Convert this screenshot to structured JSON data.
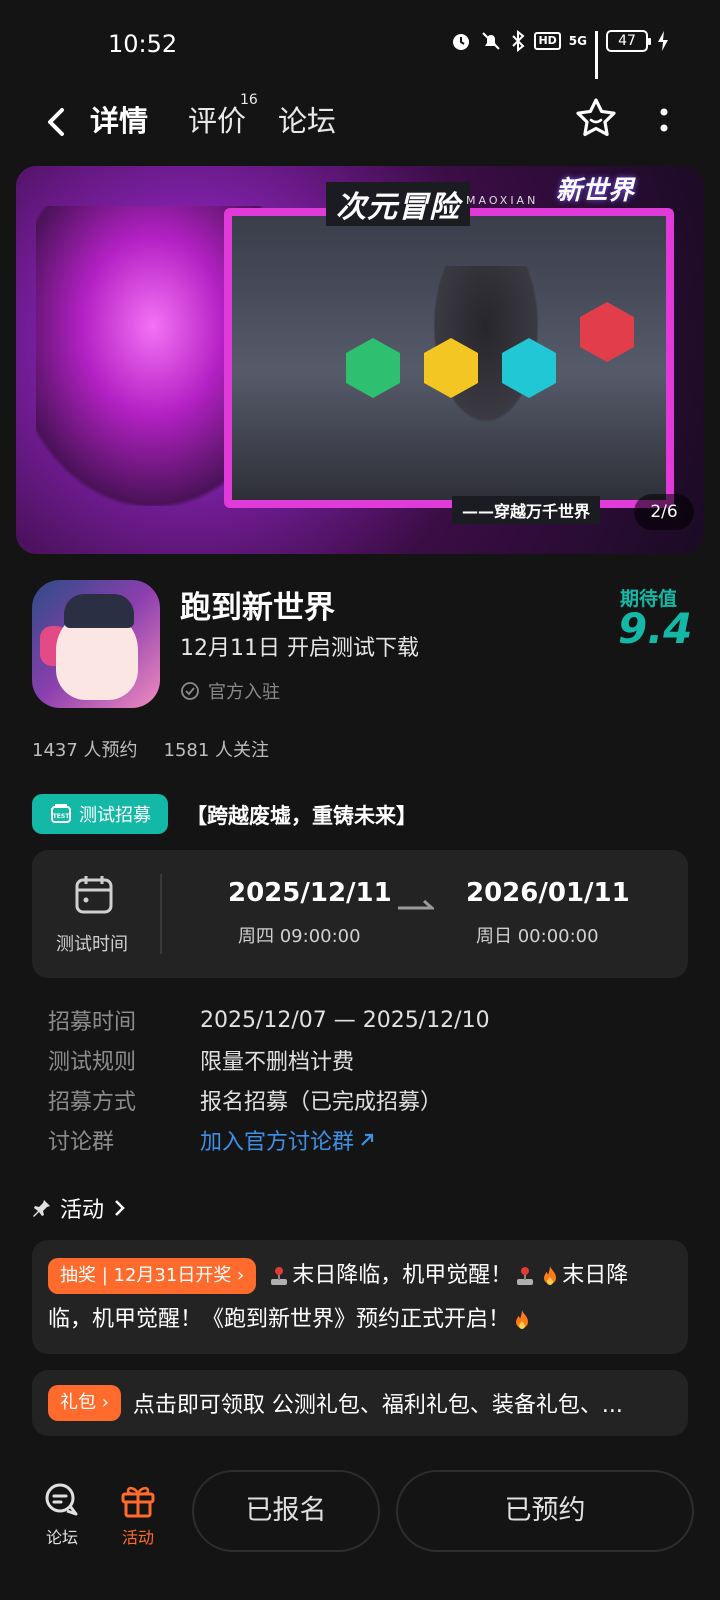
{
  "status_bar": {
    "time": "10:52",
    "hd": "HD",
    "network": "5G",
    "battery": "47"
  },
  "nav": {
    "tabs": [
      {
        "label": "详情"
      },
      {
        "label": "评价",
        "badge": "16"
      },
      {
        "label": "论坛"
      }
    ]
  },
  "banner": {
    "title": "次元冒险",
    "subtitle": "MAOXIAN",
    "logo": "新世界",
    "slogan": "——穿越万千世界",
    "counter": "2/6"
  },
  "app": {
    "name": "跑到新世界",
    "date_line": "12月11日 开启测试下载",
    "official": "官方入驻",
    "expect_label": "期待值",
    "expect_value": "9.4"
  },
  "stats": {
    "reservations": "1437 人预约",
    "followers": "1581 人关注"
  },
  "recruit": {
    "badge": "测试招募",
    "title": "【跨越废墟，重铸未来】",
    "test_label": "测试时间",
    "start_date": "2025/12/11",
    "start_time": "周四  09:00:00",
    "end_date": "2026/01/11",
    "end_time": "周日  00:00:00",
    "rows": [
      {
        "key": "招募时间",
        "value": "2025/12/07 — 2025/12/10"
      },
      {
        "key": "测试规则",
        "value": "限量不删档计费"
      },
      {
        "key": "招募方式",
        "value": "报名招募（已完成招募）"
      },
      {
        "key": "讨论群",
        "value": "加入官方讨论群"
      }
    ]
  },
  "activity": {
    "header": "活动",
    "lottery_tag": "抽奖 | 12月31日开奖 ›",
    "lottery_text_a": "末日降临，机甲觉醒！",
    "lottery_text_b": "末日降临，机甲觉醒！《跑到新世界》预约正式开启！",
    "gift_tag": "礼包 ›",
    "gift_text": "点击即可领取 公测礼包、福利礼包、装备礼包、..."
  },
  "bottom": {
    "forum": "论坛",
    "activity": "活动",
    "signed_button": "已报名",
    "reserved_button": "已预约"
  },
  "colors": {
    "accent": "#14b8a6",
    "orange": "#ff6b2c",
    "link": "#3e8fe6",
    "background": "#141414",
    "card": "#232323"
  }
}
